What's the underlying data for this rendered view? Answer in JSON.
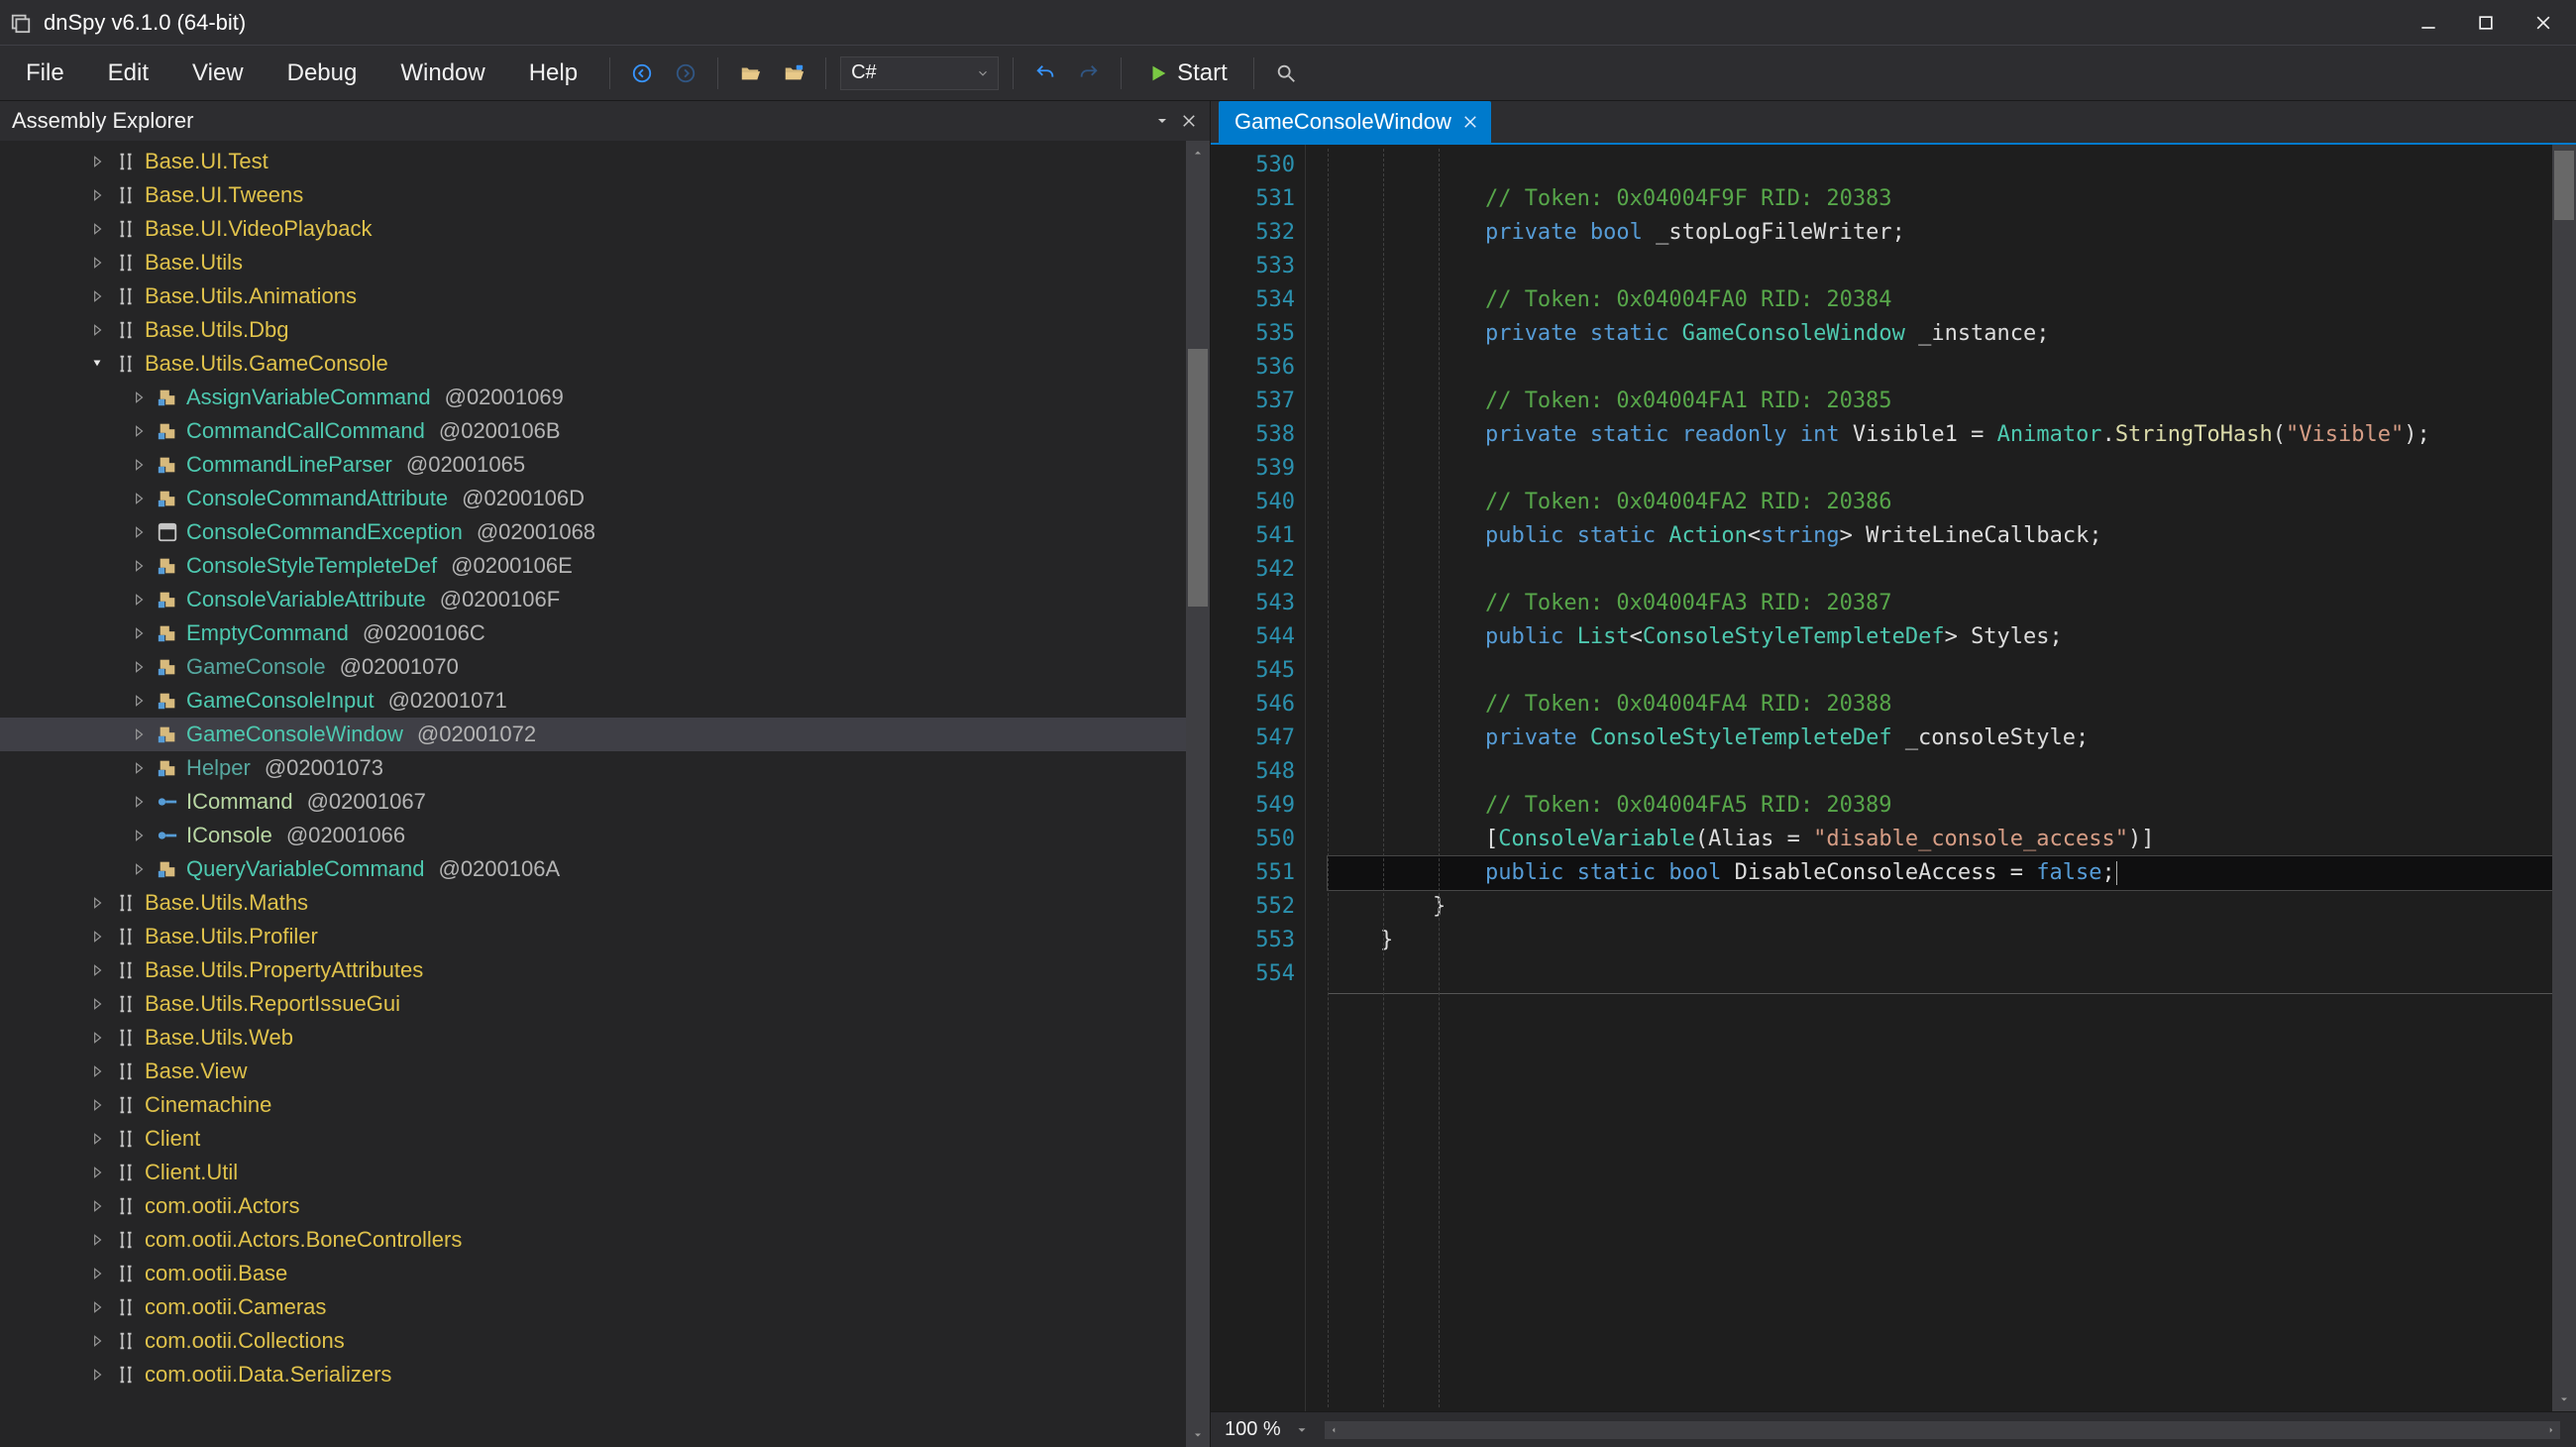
{
  "window": {
    "title": "dnSpy v6.1.0 (64-bit)"
  },
  "menu": {
    "file": "File",
    "edit": "Edit",
    "view": "View",
    "debug": "Debug",
    "window": "Window",
    "help": "Help"
  },
  "toolbar": {
    "language": "C#",
    "start": "Start"
  },
  "explorer": {
    "title": "Assembly Explorer",
    "nodes": [
      {
        "kind": "ns",
        "indent": 1,
        "arrow": "closed",
        "label": "Base.UI.Test"
      },
      {
        "kind": "ns",
        "indent": 1,
        "arrow": "closed",
        "label": "Base.UI.Tweens"
      },
      {
        "kind": "ns",
        "indent": 1,
        "arrow": "closed",
        "label": "Base.UI.VideoPlayback"
      },
      {
        "kind": "ns",
        "indent": 1,
        "arrow": "closed",
        "label": "Base.Utils"
      },
      {
        "kind": "ns",
        "indent": 1,
        "arrow": "closed",
        "label": "Base.Utils.Animations"
      },
      {
        "kind": "ns",
        "indent": 1,
        "arrow": "closed",
        "label": "Base.Utils.Dbg"
      },
      {
        "kind": "ns",
        "indent": 1,
        "arrow": "open",
        "label": "Base.Utils.GameConsole"
      },
      {
        "kind": "class",
        "indent": 2,
        "arrow": "closed",
        "label": "AssignVariableCommand",
        "token": "@02001069"
      },
      {
        "kind": "class",
        "indent": 2,
        "arrow": "closed",
        "label": "CommandCallCommand",
        "token": "@0200106B"
      },
      {
        "kind": "class",
        "indent": 2,
        "arrow": "closed",
        "label": "CommandLineParser",
        "token": "@02001065"
      },
      {
        "kind": "class",
        "indent": 2,
        "arrow": "closed",
        "label": "ConsoleCommandAttribute",
        "token": "@0200106D"
      },
      {
        "kind": "class",
        "indent": 2,
        "arrow": "closed",
        "style": "exc",
        "label": "ConsoleCommandException",
        "token": "@02001068"
      },
      {
        "kind": "class",
        "indent": 2,
        "arrow": "closed",
        "label": "ConsoleStyleTempleteDef",
        "token": "@0200106E"
      },
      {
        "kind": "class",
        "indent": 2,
        "arrow": "closed",
        "label": "ConsoleVariableAttribute",
        "token": "@0200106F"
      },
      {
        "kind": "class",
        "indent": 2,
        "arrow": "closed",
        "label": "EmptyCommand",
        "token": "@0200106C"
      },
      {
        "kind": "class",
        "indent": 2,
        "arrow": "closed",
        "style": "dim",
        "label": "GameConsole",
        "token": "@02001070"
      },
      {
        "kind": "class",
        "indent": 2,
        "arrow": "closed",
        "label": "GameConsoleInput",
        "token": "@02001071"
      },
      {
        "kind": "class",
        "indent": 2,
        "arrow": "closed",
        "selected": true,
        "label": "GameConsoleWindow",
        "token": "@02001072"
      },
      {
        "kind": "class",
        "indent": 2,
        "arrow": "closed",
        "style": "dim",
        "label": "Helper",
        "token": "@02001073"
      },
      {
        "kind": "iface",
        "indent": 2,
        "arrow": "closed",
        "label": "ICommand",
        "token": "@02001067"
      },
      {
        "kind": "iface",
        "indent": 2,
        "arrow": "closed",
        "label": "IConsole",
        "token": "@02001066"
      },
      {
        "kind": "class",
        "indent": 2,
        "arrow": "closed",
        "label": "QueryVariableCommand",
        "token": "@0200106A"
      },
      {
        "kind": "ns",
        "indent": 1,
        "arrow": "closed",
        "label": "Base.Utils.Maths"
      },
      {
        "kind": "ns",
        "indent": 1,
        "arrow": "closed",
        "label": "Base.Utils.Profiler"
      },
      {
        "kind": "ns",
        "indent": 1,
        "arrow": "closed",
        "label": "Base.Utils.PropertyAttributes"
      },
      {
        "kind": "ns",
        "indent": 1,
        "arrow": "closed",
        "label": "Base.Utils.ReportIssueGui"
      },
      {
        "kind": "ns",
        "indent": 1,
        "arrow": "closed",
        "label": "Base.Utils.Web"
      },
      {
        "kind": "ns",
        "indent": 1,
        "arrow": "closed",
        "label": "Base.View"
      },
      {
        "kind": "ns",
        "indent": 1,
        "arrow": "closed",
        "label": "Cinemachine"
      },
      {
        "kind": "ns",
        "indent": 1,
        "arrow": "closed",
        "label": "Client"
      },
      {
        "kind": "ns",
        "indent": 1,
        "arrow": "closed",
        "label": "Client.Util"
      },
      {
        "kind": "ns",
        "indent": 1,
        "arrow": "closed",
        "label": "com.ootii.Actors"
      },
      {
        "kind": "ns",
        "indent": 1,
        "arrow": "closed",
        "label": "com.ootii.Actors.BoneControllers"
      },
      {
        "kind": "ns",
        "indent": 1,
        "arrow": "closed",
        "label": "com.ootii.Base"
      },
      {
        "kind": "ns",
        "indent": 1,
        "arrow": "closed",
        "label": "com.ootii.Cameras"
      },
      {
        "kind": "ns",
        "indent": 1,
        "arrow": "closed",
        "label": "com.ootii.Collections"
      },
      {
        "kind": "ns",
        "indent": 1,
        "arrow": "closed",
        "label": "com.ootii.Data.Serializers"
      }
    ]
  },
  "editor": {
    "tab_label": "GameConsoleWindow",
    "first_line": 530,
    "zoom": "100 %",
    "html_lines": [
      "",
      "            <span class='c-cmt'>// Token: 0x04004F9F RID: 20383</span>",
      "            <span class='c-kw'>private</span> <span class='c-kw'>bool</span> <span class='c-id'>_stopLogFileWriter</span>;",
      "",
      "            <span class='c-cmt'>// Token: 0x04004FA0 RID: 20384</span>",
      "            <span class='c-kw'>private</span> <span class='c-kw'>static</span> <span class='c-type'>GameConsoleWindow</span> <span class='c-id'>_instance</span>;",
      "",
      "            <span class='c-cmt'>// Token: 0x04004FA1 RID: 20385</span>",
      "            <span class='c-kw'>private</span> <span class='c-kw'>static</span> <span class='c-kw'>readonly</span> <span class='c-kw'>int</span> <span class='c-id'>Visible1</span> = <span class='c-type'>Animator</span>.<span class='c-call'>StringToHash</span>(<span class='c-str'>\"Visible\"</span>);",
      "",
      "            <span class='c-cmt'>// Token: 0x04004FA2 RID: 20386</span>",
      "            <span class='c-kw'>public</span> <span class='c-kw'>static</span> <span class='c-type'>Action</span>&lt;<span class='c-kw'>string</span>&gt; <span class='c-id'>WriteLineCallback</span>;",
      "",
      "            <span class='c-cmt'>// Token: 0x04004FA3 RID: 20387</span>",
      "            <span class='c-kw'>public</span> <span class='c-type'>List</span>&lt;<span class='c-type'>ConsoleStyleTempleteDef</span>&gt; <span class='c-id'>Styles</span>;",
      "",
      "            <span class='c-cmt'>// Token: 0x04004FA4 RID: 20388</span>",
      "            <span class='c-kw'>private</span> <span class='c-type'>ConsoleStyleTempleteDef</span> <span class='c-id'>_consoleStyle</span>;",
      "",
      "            <span class='c-cmt'>// Token: 0x04004FA5 RID: 20389</span>",
      "            [<span class='c-type'>ConsoleVariable</span>(<span class='c-id'>Alias</span> = <span class='c-str'>\"disable_console_access\"</span>)]",
      "            <span class='c-kw'>public</span> <span class='c-kw'>static</span> <span class='c-kw'>bool</span> <span class='c-id'>DisableConsoleAccess</span> = <span class='c-kw'>false</span>;",
      "        }",
      "    }",
      ""
    ],
    "current_line_index": 21
  }
}
